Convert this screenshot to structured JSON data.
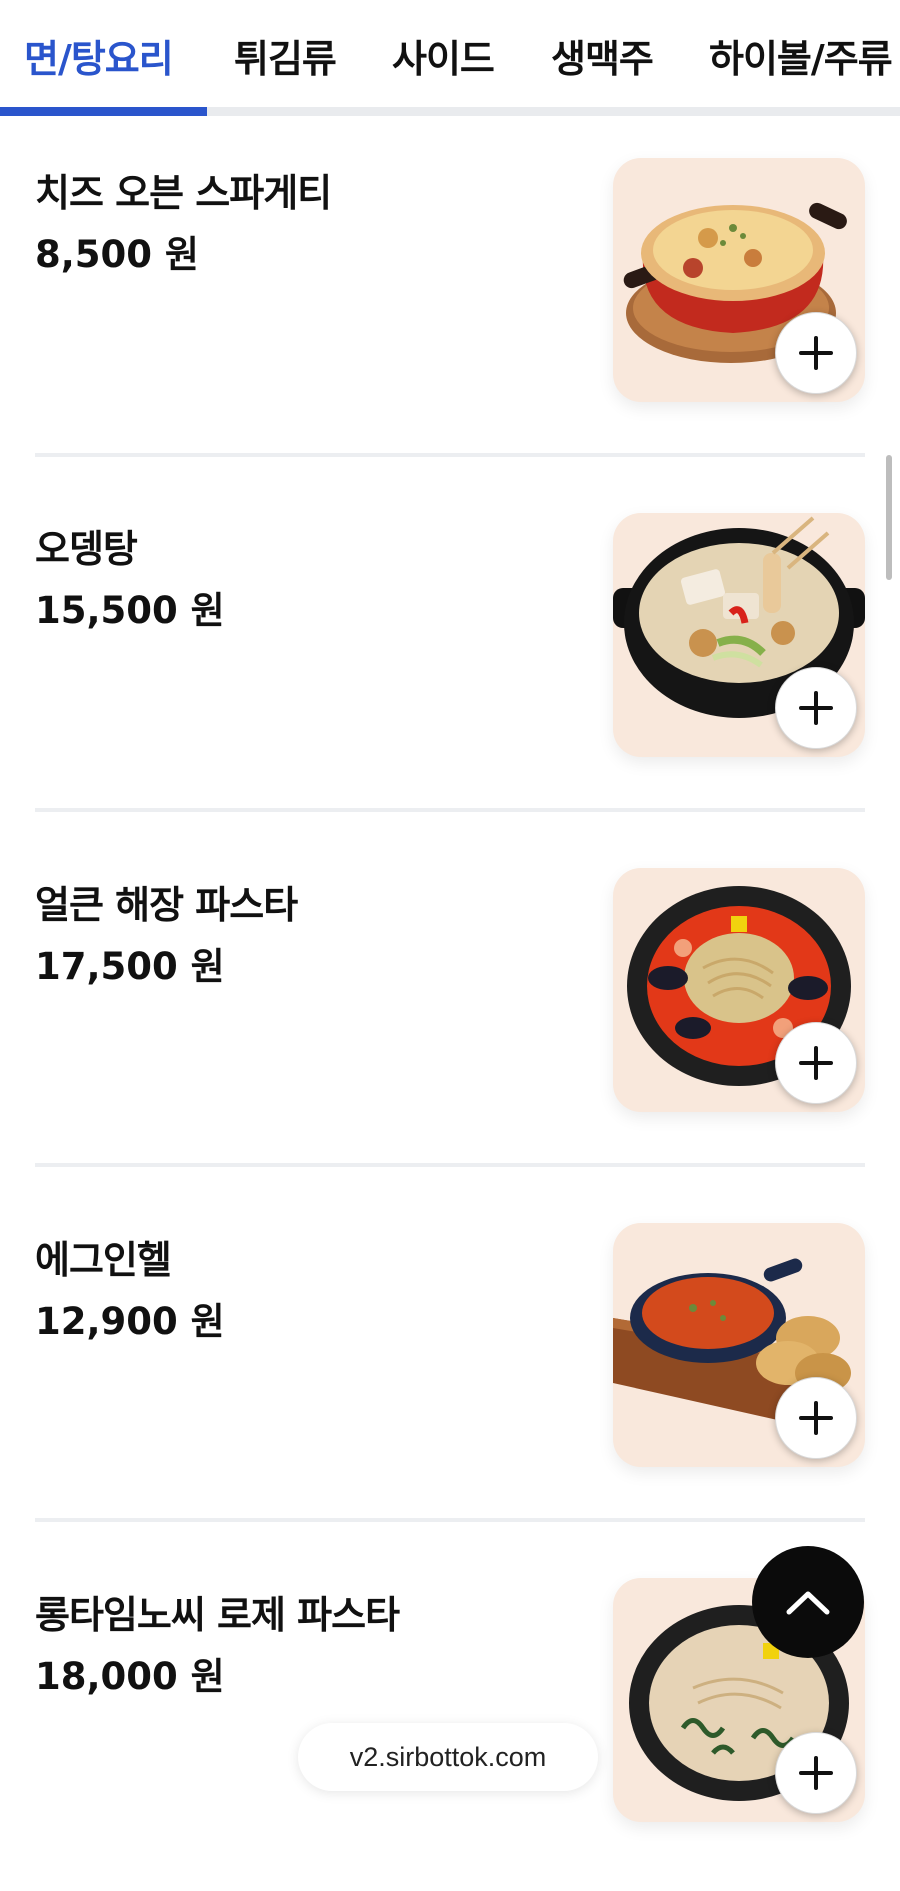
{
  "tabs": [
    {
      "label": "면/탕요리",
      "active": true
    },
    {
      "label": "튀김류",
      "active": false
    },
    {
      "label": "사이드",
      "active": false
    },
    {
      "label": "생맥주",
      "active": false
    },
    {
      "label": "하이볼/주류",
      "active": false
    }
  ],
  "menu": [
    {
      "name": "치즈 오븐 스파게티",
      "price": "8,500 원",
      "image_icon": "cheese-oven-spaghetti-image"
    },
    {
      "name": "오뎅탕",
      "price": "15,500 원",
      "image_icon": "odeng-tang-image"
    },
    {
      "name": "얼큰 해장 파스타",
      "price": "17,500 원",
      "image_icon": "spicy-haejang-pasta-image"
    },
    {
      "name": "에그인헬",
      "price": "12,900 원",
      "image_icon": "egg-in-hell-image"
    },
    {
      "name": "롱타임노씨 로제 파스타",
      "price": "18,000 원",
      "image_icon": "rose-pasta-image"
    }
  ],
  "icons": {
    "add": "plus-icon",
    "scroll_top": "chevron-up-icon"
  },
  "browser": {
    "url": "v2.sirbottok.com"
  },
  "colors": {
    "accent": "#2a55cc",
    "thumb_bg": "#f9e8dc",
    "divider": "#eceef1"
  }
}
